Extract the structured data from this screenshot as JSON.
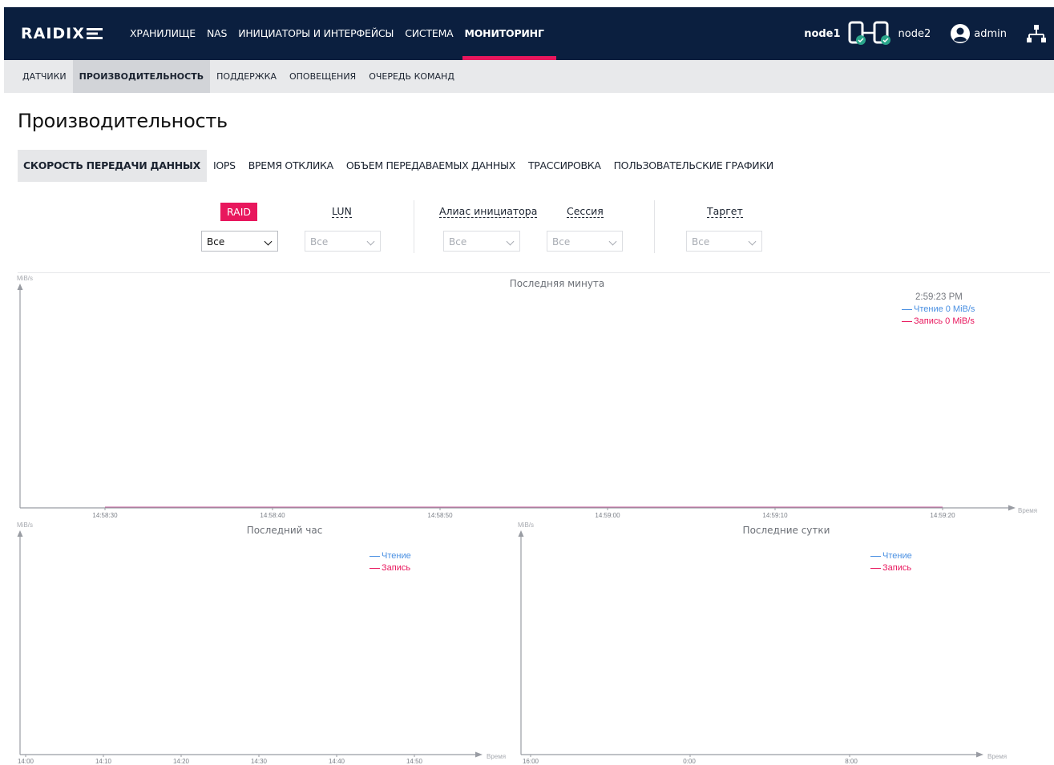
{
  "app": {
    "logo": "RAIDIX",
    "nav": [
      {
        "label": "ХРАНИЛИЩЕ",
        "active": false
      },
      {
        "label": "NAS",
        "active": false
      },
      {
        "label": "ИНИЦИАТОРЫ И ИНТЕРФЕЙСЫ",
        "active": false
      },
      {
        "label": "СИСТЕМА",
        "active": false
      },
      {
        "label": "МОНИТОРИНГ",
        "active": true
      }
    ],
    "node1": "node1",
    "node2": "node2",
    "user": "admin"
  },
  "subnav": [
    {
      "label": "ДАТЧИКИ",
      "active": false
    },
    {
      "label": "ПРОИЗВОДИТЕЛЬНОСТЬ",
      "active": true
    },
    {
      "label": "ПОДДЕРЖКА",
      "active": false
    },
    {
      "label": "ОПОВЕЩЕНИЯ",
      "active": false
    },
    {
      "label": "ОЧЕРЕДЬ КОМАНД",
      "active": false
    }
  ],
  "page_title": "Производительность",
  "tabs": [
    {
      "label": "СКОРОСТЬ ПЕРЕДАЧИ ДАННЫХ",
      "active": true
    },
    {
      "label": "IOPS",
      "active": false
    },
    {
      "label": "ВРЕМЯ ОТКЛИКА",
      "active": false
    },
    {
      "label": "ОБЪЕМ ПЕРЕДАВАЕМЫХ ДАННЫХ",
      "active": false
    },
    {
      "label": "ТРАССИРОВКА",
      "active": false
    },
    {
      "label": "ПОЛЬЗОВАТЕЛЬСКИЕ ГРАФИКИ",
      "active": false
    }
  ],
  "filters": {
    "raid": {
      "label": "RAID",
      "value": "Все"
    },
    "lun": {
      "label": "LUN",
      "value": "Все"
    },
    "initiator_alias": {
      "label": "Алиас инициатора",
      "value": "Все"
    },
    "session": {
      "label": "Сессия",
      "value": "Все"
    },
    "target": {
      "label": "Таргет",
      "value": "Все"
    }
  },
  "colors": {
    "read": "#4a90e2",
    "write": "#e8175d",
    "accent": "#e8175d",
    "header_bg": "#0b1f3f",
    "node_ok": "#2aa58a"
  },
  "chart_data": [
    {
      "type": "line",
      "title": "Последняя минута",
      "ylabel": "MiB/s",
      "xlabel": "Время",
      "x_ticks": [
        "14:58:30",
        "14:58:40",
        "14:58:50",
        "14:59:00",
        "14:59:10",
        "14:59:20"
      ],
      "tooltip_time": "2:59:23 PM",
      "series": [
        {
          "name": "Чтение",
          "legend": "Чтение 0 MiB/s",
          "values": [
            0,
            0,
            0,
            0,
            0,
            0
          ]
        },
        {
          "name": "Запись",
          "legend": "Запись 0 MiB/s",
          "values": [
            0,
            0,
            0,
            0,
            0,
            0
          ]
        }
      ]
    },
    {
      "type": "line",
      "title": "Последний час",
      "ylabel": "MiB/s",
      "xlabel": "Время",
      "x_ticks": [
        "14:00",
        "14:10",
        "14:20",
        "14:30",
        "14:40",
        "14:50"
      ],
      "series": [
        {
          "name": "Чтение",
          "legend": "Чтение"
        },
        {
          "name": "Запись",
          "legend": "Запись"
        }
      ]
    },
    {
      "type": "line",
      "title": "Последние сутки",
      "ylabel": "MiB/s",
      "xlabel": "Время",
      "x_ticks": [
        "16:00",
        "0:00",
        "8:00"
      ],
      "series": [
        {
          "name": "Чтение",
          "legend": "Чтение"
        },
        {
          "name": "Запись",
          "legend": "Запись"
        }
      ]
    }
  ]
}
